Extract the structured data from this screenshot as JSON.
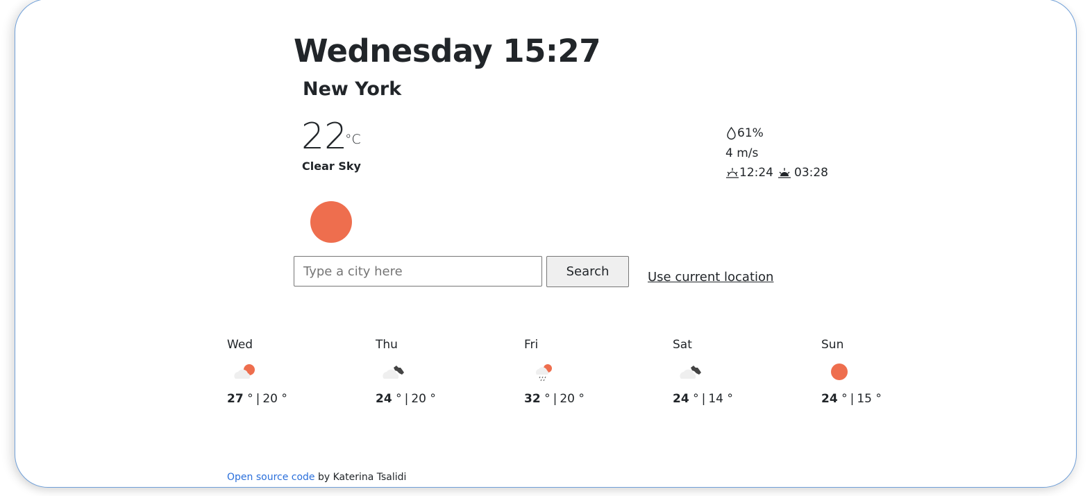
{
  "header": {
    "title": "Wednesday 15:27",
    "city": "New York"
  },
  "current": {
    "temperature": "22",
    "unit": "°C",
    "description": "Clear Sky",
    "icon": "sun-icon",
    "humidity": "61%",
    "wind": "4 m/s",
    "sunrise": "12:24",
    "sunset": "03:28"
  },
  "search": {
    "placeholder": "Type a city here",
    "value": "",
    "button_label": "Search",
    "location_link": "Use current location"
  },
  "forecast": [
    {
      "day": "Wed",
      "icon": "partly-cloudy-icon",
      "max": "27",
      "min": "20",
      "deg": "°"
    },
    {
      "day": "Thu",
      "icon": "broken-clouds-icon",
      "max": "24",
      "min": "20",
      "deg": "°"
    },
    {
      "day": "Fri",
      "icon": "rain-sun-icon",
      "max": "32",
      "min": "20",
      "deg": "°"
    },
    {
      "day": "Sat",
      "icon": "broken-clouds-icon",
      "max": "24",
      "min": "14",
      "deg": "°"
    },
    {
      "day": "Sun",
      "icon": "sun-icon",
      "max": "24",
      "min": "15",
      "deg": "°"
    }
  ],
  "footer": {
    "link": "Open source code",
    "text": " by Katerina Tsalidi"
  },
  "colors": {
    "accent_sun": "#ee6e4e",
    "cloud": "#efefef",
    "dark_cloud": "#444444",
    "link": "#2a6fdb",
    "border": "#6f9fd8"
  }
}
